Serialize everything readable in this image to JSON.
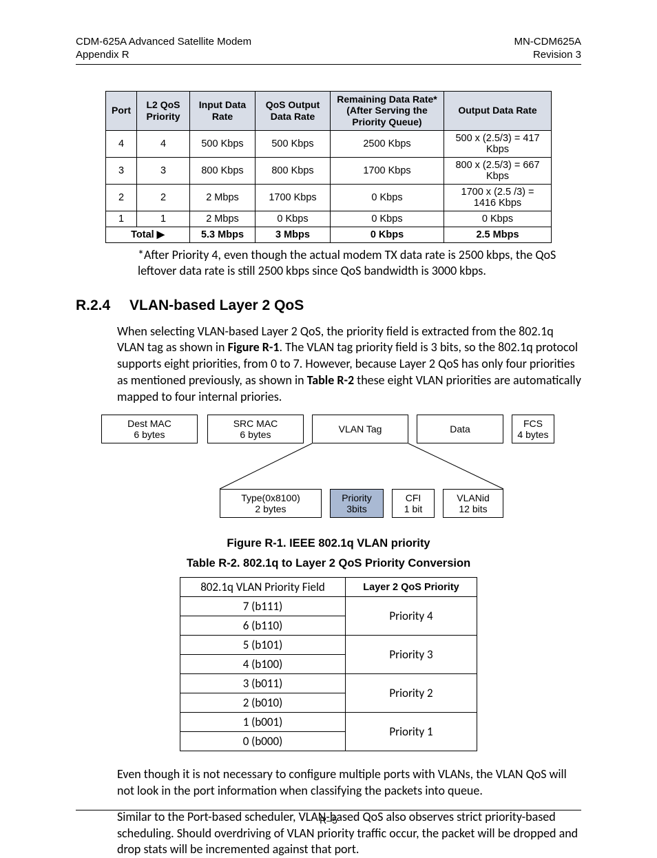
{
  "header": {
    "left1": "CDM-625A Advanced Satellite Modem",
    "left2": "Appendix R",
    "right1": "MN-CDM625A",
    "right2": "Revision 3"
  },
  "table1": {
    "headers": [
      "Port",
      "L2 QoS Priority",
      "Input Data Rate",
      "QoS Output Data Rate",
      "Remaining Data Rate* (After Serving the Priority Queue)",
      "Output Data Rate"
    ],
    "rows": [
      [
        "4",
        "4",
        "500 Kbps",
        "500 Kbps",
        "2500 Kbps",
        "500 x (2.5/3) = 417 Kbps"
      ],
      [
        "3",
        "3",
        "800 Kbps",
        "800 Kbps",
        "1700 Kbps",
        "800 x (2.5/3) = 667 Kbps"
      ],
      [
        "2",
        "2",
        "2 Mbps",
        "1700 Kbps",
        "0 Kbps",
        "1700 x (2.5 /3) = 1416 Kbps"
      ],
      [
        "1",
        "1",
        "2 Mbps",
        "0 Kbps",
        "0 Kbps",
        "0 Kbps"
      ]
    ],
    "total": [
      "Total ▶",
      "5.3 Mbps",
      "3 Mbps",
      "0 Kbps",
      "2.5 Mbps"
    ]
  },
  "note_after_t1": "*After Priority 4, even though the actual modem TX data rate is 2500 kbps, the QoS leftover data rate is still 2500 kbps since QoS bandwidth is 3000 kbps.",
  "section": {
    "num": "R.2.4",
    "title": "VLAN-based Layer 2 QoS"
  },
  "para1_pre": "When selecting VLAN-based Layer 2 QoS, the priority field is extracted from the 802.1q VLAN tag as shown in ",
  "para1_fig": "Figure R-1",
  "para1_mid": ". The VLAN tag priority field is 3 bits, so the 802.1q protocol supports eight priorities, from 0 to 7. However, because Layer 2 QoS has only four priorities as mentioned previously, as shown in ",
  "para1_tab": "Table R-2",
  "para1_post": " these eight VLAN priorities are automatically mapped to four internal priories.",
  "figure": {
    "dest_mac": "Dest MAC\n6 bytes",
    "src_mac": "SRC  MAC\n6 bytes",
    "vlan_tag": "VLAN Tag",
    "data": "Data",
    "fcs": "FCS\n4 bytes",
    "type": "Type(0x8100)\n2 bytes",
    "priority": "Priority\n3bits",
    "cfi": "CFI\n1 bit",
    "vlanid": "VLANid\n12 bits"
  },
  "caption_fig": "Figure R-1. IEEE 802.1q VLAN priority",
  "caption_tab": "Table R-2. 802.1q to Layer 2 QoS Priority Conversion",
  "table2": {
    "headers": [
      "802.1q VLAN Priority Field",
      "Layer 2 QoS Priority"
    ],
    "groups": [
      {
        "rows": [
          "7 (b111)",
          "6 (b110)"
        ],
        "priority": "Priority 4"
      },
      {
        "rows": [
          "5 (b101)",
          "4 (b100)"
        ],
        "priority": "Priority 3"
      },
      {
        "rows": [
          "3 (b011)",
          "2 (b010)"
        ],
        "priority": "Priority 2"
      },
      {
        "rows": [
          "1 (b001)",
          "0 (b000)"
        ],
        "priority": "Priority 1"
      }
    ]
  },
  "para2": "Even though it is not necessary to configure multiple ports with VLANs, the VLAN QoS will not look in the port information when classifying the packets into queue.",
  "para3": "Similar to the Port-based scheduler, VLAN-based QoS also observes strict priority-based scheduling. Should overdriving of VLAN priority traffic occur, the packet will be dropped and drop stats will be incremented against that port.",
  "footer": "R–5"
}
